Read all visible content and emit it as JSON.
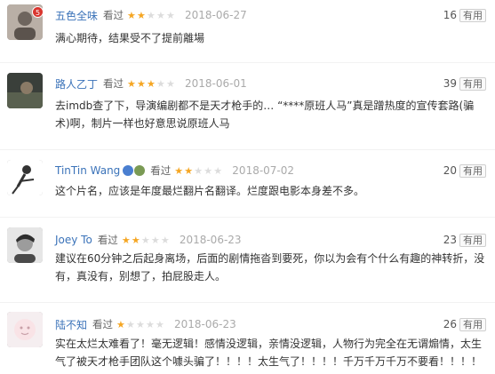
{
  "useful_label": "有用",
  "comments": [
    {
      "username": "五色全味",
      "action": "看过",
      "rating": 2,
      "date": "2018-06-27",
      "useful_count": "16",
      "avatar_badge": "5",
      "text": "满心期待，结果受不了提前離場"
    },
    {
      "username": "路人乙丁",
      "action": "看过",
      "rating": 3,
      "date": "2018-06-01",
      "useful_count": "39",
      "text": "去imdb查了下，导演编剧都不是天才枪手的… “****原班人马”真是蹭热度的宣传套路(骗术)啊，制片一样也好意思说原班人马"
    },
    {
      "username": "TinTin Wang",
      "action": "看过",
      "rating": 2,
      "date": "2018-07-02",
      "useful_count": "20",
      "text": "这个片名，应该是年度最烂翻片名翻译。烂度跟电影本身差不多。"
    },
    {
      "username": "Joey To",
      "action": "看过",
      "rating": 2,
      "date": "2018-06-23",
      "useful_count": "23",
      "text": "建议在60分钟之后起身离场，后面的剧情拖沓到要死，你以为会有个什么有趣的神转折，没有，真没有，别想了，拍屁股走人。"
    },
    {
      "username": "陆不知",
      "action": "看过",
      "rating": 1,
      "date": "2018-06-23",
      "useful_count": "26",
      "text": "实在太烂太难看了！毫无逻辑！感情没逻辑，亲情没逻辑，人物行为完全在无谓煽情，太生气了被天才枪手团队这个噱头骗了！！！！太生气了！！！！千万千万千万不要看！！！！"
    }
  ],
  "colors": {
    "username": "#3b73b9",
    "star_on": "#f5a623",
    "star_off": "#dcdcdc",
    "date": "#aaaaaa"
  }
}
